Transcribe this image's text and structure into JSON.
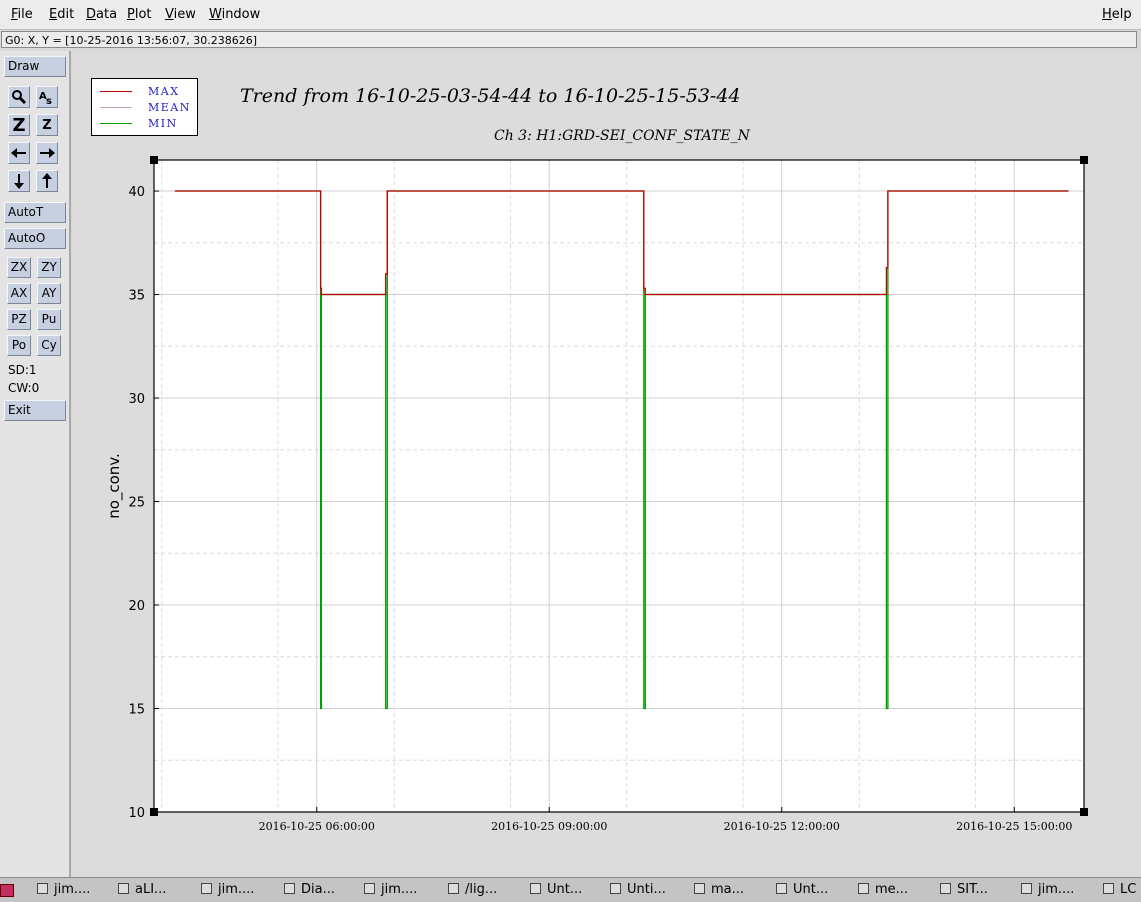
{
  "menu": {
    "left": [
      "File",
      "Edit",
      "Data",
      "Plot",
      "View",
      "Window"
    ],
    "help": "Help"
  },
  "status": "G0: X, Y = [10-25-2016 13:56:07, 30.238626]",
  "toolbar": {
    "draw": "Draw",
    "autoT": "AutoT",
    "autoO": "AutoO",
    "zx": "ZX",
    "zy": "ZY",
    "ax": "AX",
    "ay": "AY",
    "pz": "PZ",
    "pu": "Pu",
    "po": "Po",
    "cy": "Cy",
    "sd": "SD:1",
    "cw": "CW:0",
    "exit": "Exit",
    "icons": [
      "magnify-icon",
      "as-text-icon",
      "zoom-z-large-icon",
      "zoom-z-small-icon",
      "arrow-left-icon",
      "arrow-right-icon",
      "arrow-down-icon",
      "arrow-up-icon"
    ]
  },
  "plot": {
    "title": "Trend from 16-10-25-03-54-44 to 16-10-25-15-53-44",
    "subtitle": "Ch 3: H1:GRD-SEI_CONF_STATE_N",
    "legend": [
      {
        "label": "MAX",
        "color": "#c00000"
      },
      {
        "label": "MEAN",
        "color": "#d0a0c0"
      },
      {
        "label": "MIN",
        "color": "#00a000"
      }
    ]
  },
  "chart_data": {
    "type": "line",
    "ylabel": "no_conv.",
    "xlabel": "",
    "ylim": [
      10,
      41.5
    ],
    "y_ticks": [
      10,
      15,
      20,
      25,
      30,
      35,
      40
    ],
    "x_tick_labels": [
      "2016-10-25 06:00:00",
      "2016-10-25 09:00:00",
      "2016-10-25 12:00:00",
      "2016-10-25 15:00:00"
    ],
    "x_tick_hours": [
      6,
      9,
      12,
      15
    ],
    "xlim_hours": [
      3.9,
      15.9
    ],
    "grid": true,
    "series": [
      {
        "name": "MAX",
        "color": "#c00000",
        "x": [
          4.17,
          6.05,
          6.05,
          6.06,
          6.06,
          6.89,
          6.89,
          6.91,
          6.91,
          10.22,
          10.22,
          10.24,
          10.24,
          13.35,
          13.35,
          13.37,
          13.37,
          15.7
        ],
        "y": [
          40,
          40,
          35.3,
          35.3,
          35,
          35,
          36,
          36,
          40,
          40,
          35.3,
          35.3,
          35,
          35,
          36.3,
          36.3,
          40,
          40
        ]
      },
      {
        "name": "MIN",
        "color": "#00a000",
        "x": [
          4.17,
          6.05,
          6.05,
          6.06,
          6.06,
          6.89,
          6.89,
          6.91,
          6.91,
          10.22,
          10.22,
          10.24,
          10.24,
          13.35,
          13.35,
          13.37,
          13.37,
          15.7
        ],
        "y": [
          40,
          40,
          15,
          15,
          35,
          35,
          15,
          15,
          40,
          40,
          15,
          15,
          35,
          35,
          15,
          15,
          40,
          40
        ]
      }
    ]
  },
  "taskbar": [
    {
      "label": "jim....",
      "icon": "terminal-icon"
    },
    {
      "label": "aLI...",
      "icon": "firefox-icon"
    },
    {
      "label": "jim....",
      "icon": "terminal-icon"
    },
    {
      "label": "Dia...",
      "icon": "window-icon"
    },
    {
      "label": "jim....",
      "icon": "terminal-icon"
    },
    {
      "label": "/lig...",
      "icon": "folder-icon"
    },
    {
      "label": "Unt...",
      "icon": "image-icon"
    },
    {
      "label": "Unti...",
      "icon": "image-icon"
    },
    {
      "label": "ma...",
      "icon": "editor-icon"
    },
    {
      "label": "Unt...",
      "icon": "image-icon"
    },
    {
      "label": "me...",
      "icon": "window-icon"
    },
    {
      "label": "SIT...",
      "icon": "window-icon"
    },
    {
      "label": "jim....",
      "icon": "terminal-icon"
    },
    {
      "label": "LC",
      "icon": "window-icon"
    }
  ]
}
